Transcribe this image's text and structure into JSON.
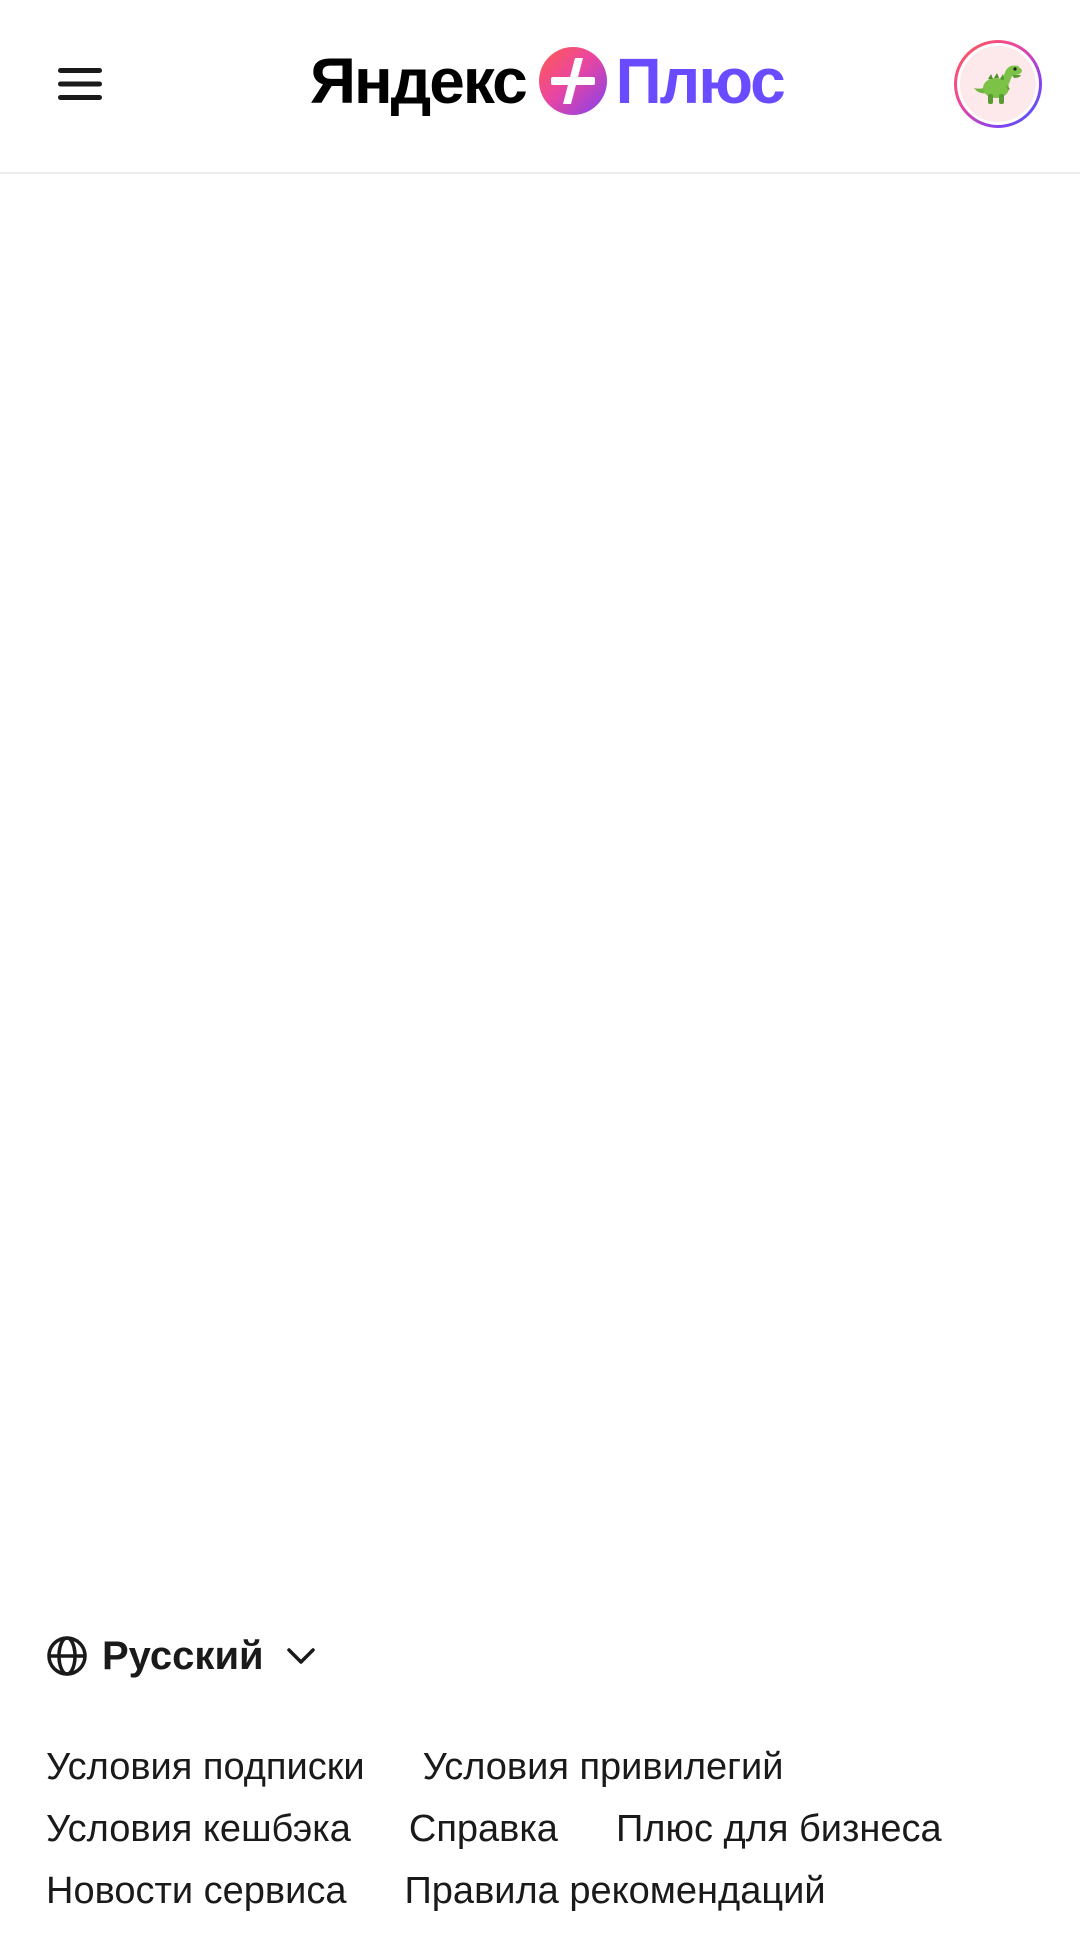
{
  "header": {
    "logo_yandex": "Яндекс",
    "logo_plus": "Плюс",
    "menu_icon": "hamburger-menu-icon",
    "avatar_icon": "dinosaur-avatar"
  },
  "footer": {
    "language": {
      "label": "Русский",
      "icon": "globe-icon",
      "chevron": "chevron-down-icon"
    },
    "links": [
      [
        "Условия подписки",
        "Условия привилегий"
      ],
      [
        "Условия кешбэка",
        "Справка",
        "Плюс для бизнеса"
      ],
      [
        "Новости сервиса",
        "Правила рекомендаций"
      ]
    ]
  },
  "colors": {
    "plus_accent": "#6b4bff",
    "background": "#ffffff",
    "text": "#1a1a1a"
  }
}
